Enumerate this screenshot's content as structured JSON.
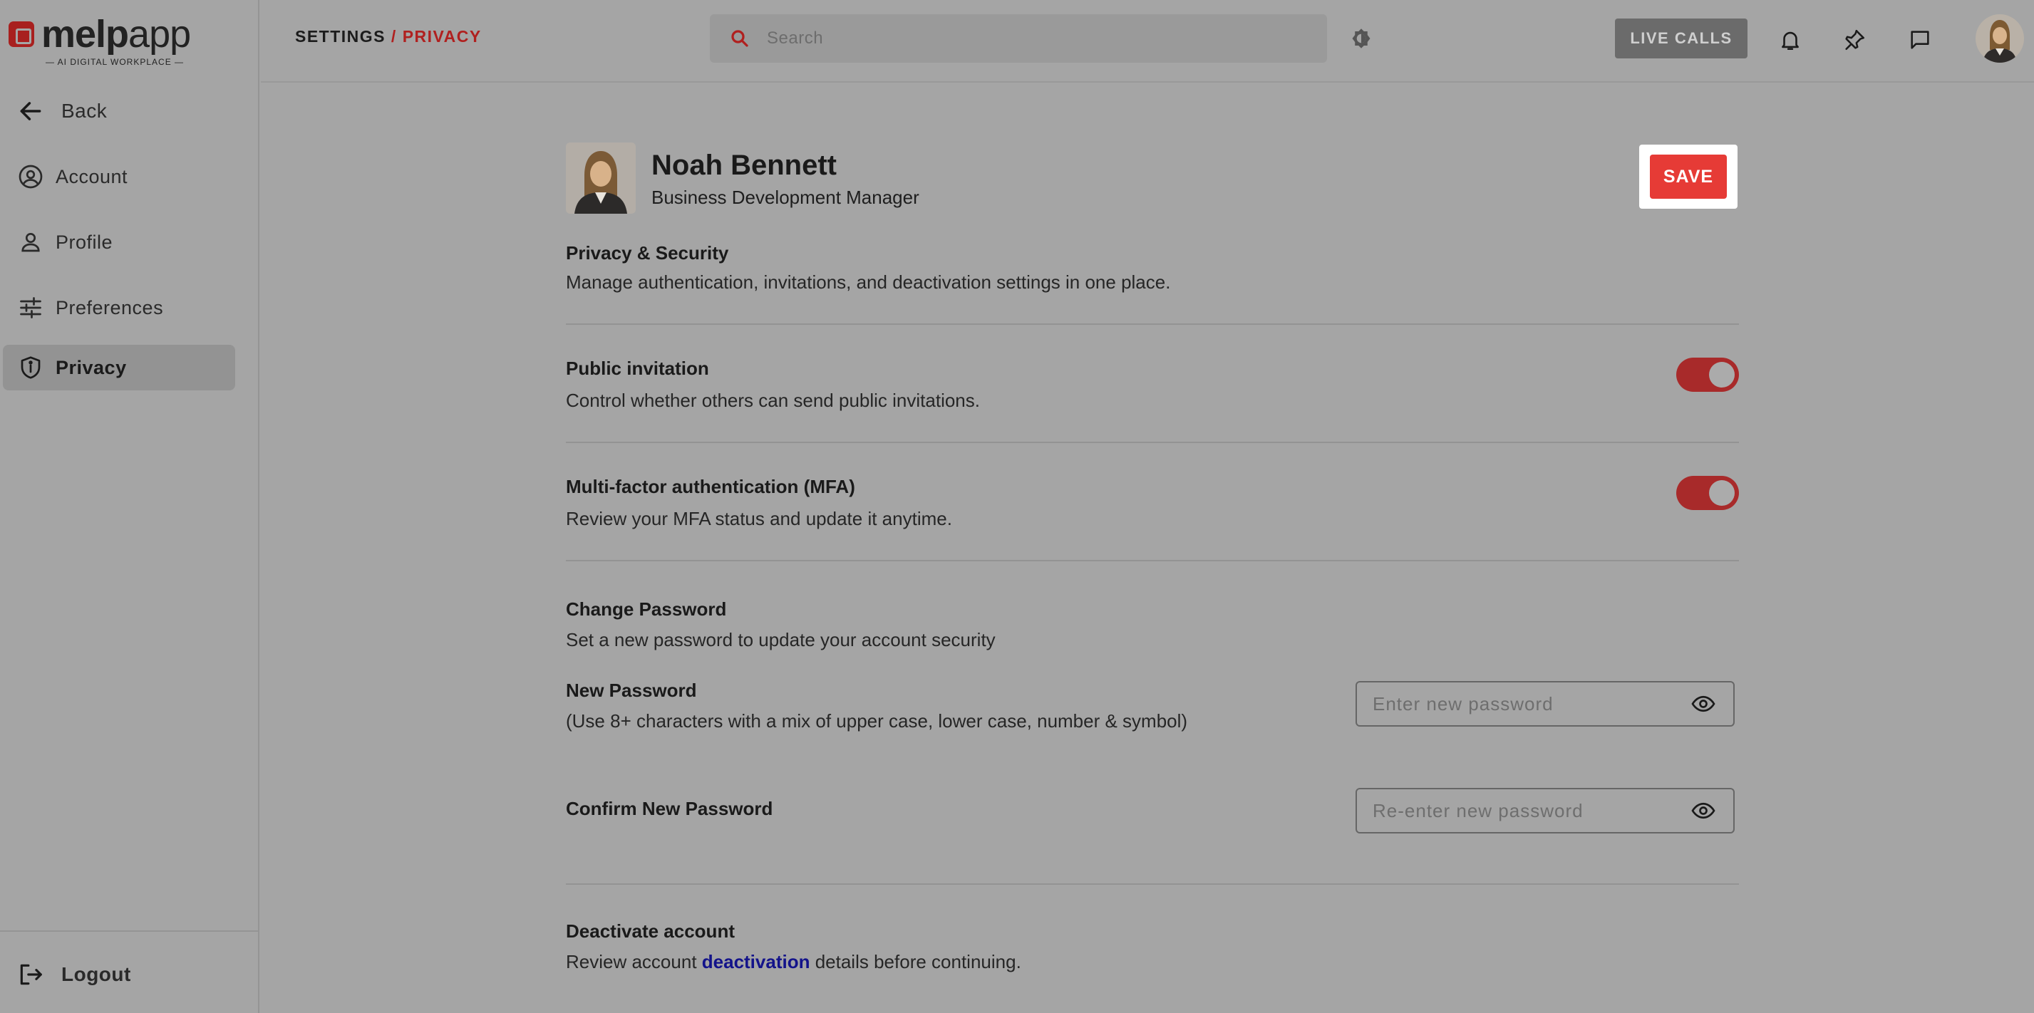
{
  "logo": {
    "brand_bold": "melp",
    "brand_light": "app",
    "tagline": "— AI DIGITAL WORKPLACE —"
  },
  "sidebar": {
    "back_label": "Back",
    "items": [
      {
        "label": "Account",
        "icon": "account-circle-icon"
      },
      {
        "label": "Profile",
        "icon": "person-icon"
      },
      {
        "label": "Preferences",
        "icon": "sliders-icon"
      },
      {
        "label": "Privacy",
        "icon": "shield-icon",
        "active": true
      }
    ],
    "logout_label": "Logout"
  },
  "header": {
    "breadcrumb_root": "SETTINGS",
    "breadcrumb_sep": " / ",
    "breadcrumb_current": "PRIVACY",
    "search_placeholder": "Search",
    "live_calls_label": "LIVE CALLS"
  },
  "profile": {
    "name": "Noah Bennett",
    "title": "Business Development Manager",
    "save_label": "SAVE"
  },
  "privacy": {
    "title": "Privacy & Security",
    "desc": "Manage authentication, invitations, and deactivation settings in one place."
  },
  "public_invitation": {
    "title": "Public invitation",
    "desc": "Control whether others can send public invitations.",
    "enabled": true
  },
  "mfa": {
    "title": "Multi-factor authentication (MFA)",
    "desc": "Review your MFA status and update it anytime.",
    "enabled": true
  },
  "change_password": {
    "title": "Change Password",
    "desc": "Set a new password to update your account security",
    "new_label": "New Password",
    "new_hint": "(Use 8+ characters with a mix of upper case, lower case, number & symbol)",
    "new_placeholder": "Enter new password",
    "confirm_label": "Confirm New Password",
    "confirm_placeholder": "Re-enter new password"
  },
  "deactivate": {
    "title": "Deactivate account",
    "desc_before": "Review account ",
    "desc_link": "deactivation",
    "desc_after": " details before continuing."
  },
  "colors": {
    "accent": "#b0201f",
    "save": "#e63b36",
    "toggle_on": "#a82a2a",
    "link": "#13138a"
  }
}
